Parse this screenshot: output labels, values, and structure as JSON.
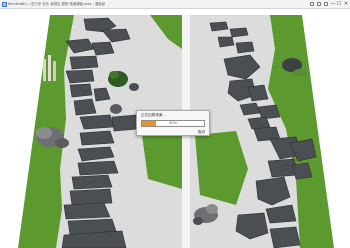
{
  "window": {
    "app_name": "Renderer",
    "title": "D:\\...\\石汀步 石头 景观石 庭院 地面铺装.max - 渲染帧",
    "minimize_glyph": "—",
    "maximize_glyph": "☐",
    "close_glyph": "✕"
  },
  "progress_dialog": {
    "title": "正在加载场景...",
    "percent_label": "50%",
    "progress": 0.22,
    "cancel_label": "取消"
  },
  "scene": {
    "colors": {
      "grass": "#5c9a2f",
      "gravel": "#dcdcdc",
      "stone": "#4b4e52",
      "divider": "#f4f4f4",
      "progress_fill": "#e5942c"
    }
  }
}
